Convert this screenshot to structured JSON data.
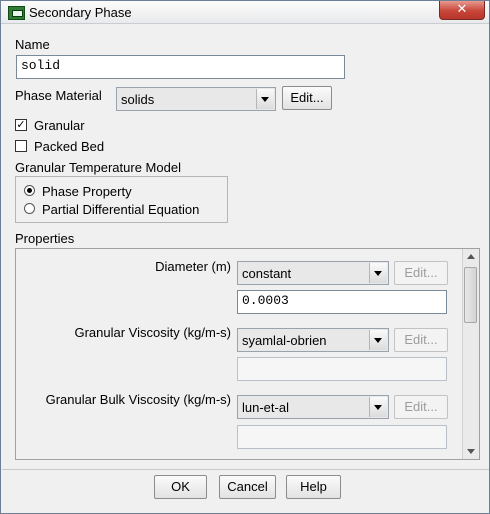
{
  "window": {
    "title": "Secondary Phase",
    "close_glyph": "✕"
  },
  "name_section": {
    "label": "Name",
    "value": "solid"
  },
  "phase_material": {
    "label": "Phase Material",
    "selected": "solids",
    "edit_label": "Edit..."
  },
  "granular": {
    "label": "Granular",
    "checked": true,
    "mark": "✓"
  },
  "packed_bed": {
    "label": "Packed Bed",
    "checked": false
  },
  "granular_temperature_model": {
    "label": "Granular Temperature Model",
    "options": [
      {
        "label": "Phase Property",
        "selected": true
      },
      {
        "label": "Partial Differential Equation",
        "selected": false
      }
    ]
  },
  "properties": {
    "label": "Properties",
    "items": [
      {
        "label": "Diameter (m)",
        "method": "constant",
        "edit_label": "Edit...",
        "value": "0.0003"
      },
      {
        "label": "Granular Viscosity (kg/m-s)",
        "method": "syamlal-obrien",
        "edit_label": "Edit...",
        "value": ""
      },
      {
        "label": "Granular Bulk Viscosity (kg/m-s)",
        "method": "lun-et-al",
        "edit_label": "Edit...",
        "value": ""
      }
    ]
  },
  "footer": {
    "ok_label": "OK",
    "cancel_label": "Cancel",
    "help_label": "Help"
  },
  "icons": {
    "app": "fluent-app-icon",
    "close": "close-icon",
    "dropdown": "chevron-down-icon"
  }
}
